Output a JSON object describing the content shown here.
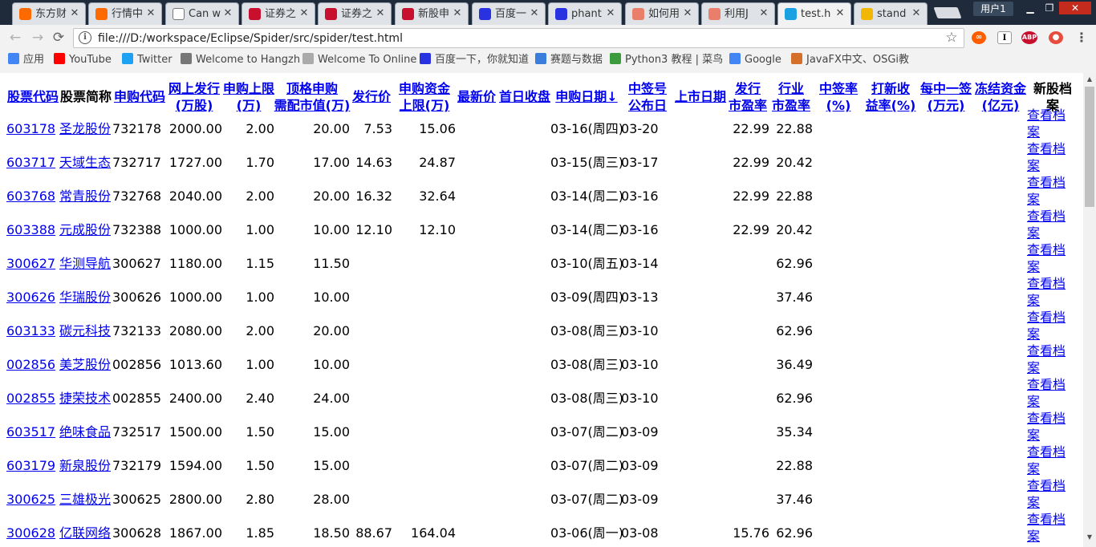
{
  "tabs": [
    {
      "title": "东方财",
      "icon_color": "#ff6a00",
      "icon": "logo-icon"
    },
    {
      "title": "行情中",
      "icon_color": "#ff6a00",
      "icon": "logo-icon"
    },
    {
      "title": "Can w",
      "icon_color": "",
      "icon": "page-icon"
    },
    {
      "title": "证券之",
      "icon_color": "#c8102e",
      "icon": "logo-icon"
    },
    {
      "title": "证券之",
      "icon_color": "#c8102e",
      "icon": "logo-icon"
    },
    {
      "title": "新股申",
      "icon_color": "#c8102e",
      "icon": "logo-icon"
    },
    {
      "title": "百度一",
      "icon_color": "#2932e1",
      "icon": "paw-icon"
    },
    {
      "title": "phant",
      "icon_color": "#2932e1",
      "icon": "paw-icon"
    },
    {
      "title": "如何用",
      "icon_color": "#e97f6a",
      "icon": "jianshu-icon"
    },
    {
      "title": "利用J",
      "icon_color": "#e97f6a",
      "icon": "jianshu-icon"
    },
    {
      "title": "test.h",
      "icon_color": "#1aa1e2",
      "icon": "globe-icon"
    },
    {
      "title": "stand",
      "icon_color": "#f2b705",
      "icon": "zhuxian-icon"
    }
  ],
  "user_button": "用户1",
  "url": "file:///D:/workspace/Eclipse/Spider/src/spider/test.html",
  "bookmarks": [
    "应用",
    "YouTube",
    "Twitter",
    "Welcome to Hangzh",
    "Welcome To Online",
    "百度一下，你就知道",
    "赛题与数据",
    "Python3 教程 | 菜鸟",
    "Google",
    "JavaFX中文、OSGi教"
  ],
  "headers": {
    "h1": "股票代码",
    "h2": "股票简称",
    "h3": "申购代码",
    "h4a": "网上发行",
    "h4b": "(万股)",
    "h5a": "申购上限",
    "h5b": "(万)",
    "h6a": "顶格申购",
    "h6b": "需配市值(万)",
    "h7": "发行价",
    "h8a": "申购资金",
    "h8b": "上限(万)",
    "h9": "最新价",
    "h10": "首日收盘",
    "h11": "申购日期↓",
    "h12a": "中签号",
    "h12b": "公布日",
    "h13": "上市日期",
    "h14a": "发行",
    "h14b": "市盈率",
    "h15a": "行业",
    "h15b": "市盈率",
    "h16a": "中签率",
    "h16b": "(%)",
    "h17a": "打新收",
    "h17b": "益率(%)",
    "h18a": "每中一签",
    "h18b": "(万元)",
    "h19a": "冻结资金",
    "h19b": "(亿元)",
    "h20a": "新股档",
    "h20b": "案"
  },
  "archive_link_a": "查看档",
  "archive_link_b": "案",
  "rows": [
    {
      "code": "603178",
      "name": "圣龙股份",
      "sub": "732178",
      "issue": "2000.00",
      "limit": "2.00",
      "mktval": "20.00",
      "price": "7.53",
      "fund": "15.06",
      "date": "03-16(周四)",
      "pub": "03-20",
      "pe": "22.99",
      "ipe": "22.88"
    },
    {
      "code": "603717",
      "name": "天域生态",
      "sub": "732717",
      "issue": "1727.00",
      "limit": "1.70",
      "mktval": "17.00",
      "price": "14.63",
      "fund": "24.87",
      "date": "03-15(周三)",
      "pub": "03-17",
      "pe": "22.99",
      "ipe": "20.42"
    },
    {
      "code": "603768",
      "name": "常青股份",
      "sub": "732768",
      "issue": "2040.00",
      "limit": "2.00",
      "mktval": "20.00",
      "price": "16.32",
      "fund": "32.64",
      "date": "03-14(周二)",
      "pub": "03-16",
      "pe": "22.99",
      "ipe": "22.88"
    },
    {
      "code": "603388",
      "name": "元成股份",
      "sub": "732388",
      "issue": "1000.00",
      "limit": "1.00",
      "mktval": "10.00",
      "price": "12.10",
      "fund": "12.10",
      "date": "03-14(周二)",
      "pub": "03-16",
      "pe": "22.99",
      "ipe": "20.42"
    },
    {
      "code": "300627",
      "name": "华测导航",
      "sub": "300627",
      "issue": "1180.00",
      "limit": "1.15",
      "mktval": "11.50",
      "price": "",
      "fund": "",
      "date": "03-10(周五)",
      "pub": "03-14",
      "pe": "",
      "ipe": "62.96"
    },
    {
      "code": "300626",
      "name": "华瑞股份",
      "sub": "300626",
      "issue": "1000.00",
      "limit": "1.00",
      "mktval": "10.00",
      "price": "",
      "fund": "",
      "date": "03-09(周四)",
      "pub": "03-13",
      "pe": "",
      "ipe": "37.46"
    },
    {
      "code": "603133",
      "name": "碳元科技",
      "sub": "732133",
      "issue": "2080.00",
      "limit": "2.00",
      "mktval": "20.00",
      "price": "",
      "fund": "",
      "date": "03-08(周三)",
      "pub": "03-10",
      "pe": "",
      "ipe": "62.96"
    },
    {
      "code": "002856",
      "name": "美芝股份",
      "sub": "002856",
      "issue": "1013.60",
      "limit": "1.00",
      "mktval": "10.00",
      "price": "",
      "fund": "",
      "date": "03-08(周三)",
      "pub": "03-10",
      "pe": "",
      "ipe": "36.49"
    },
    {
      "code": "002855",
      "name": "捷荣技术",
      "sub": "002855",
      "issue": "2400.00",
      "limit": "2.40",
      "mktval": "24.00",
      "price": "",
      "fund": "",
      "date": "03-08(周三)",
      "pub": "03-10",
      "pe": "",
      "ipe": "62.96"
    },
    {
      "code": "603517",
      "name": "绝味食品",
      "sub": "732517",
      "issue": "1500.00",
      "limit": "1.50",
      "mktval": "15.00",
      "price": "",
      "fund": "",
      "date": "03-07(周二)",
      "pub": "03-09",
      "pe": "",
      "ipe": "35.34"
    },
    {
      "code": "603179",
      "name": "新泉股份",
      "sub": "732179",
      "issue": "1594.00",
      "limit": "1.50",
      "mktval": "15.00",
      "price": "",
      "fund": "",
      "date": "03-07(周二)",
      "pub": "03-09",
      "pe": "",
      "ipe": "22.88"
    },
    {
      "code": "300625",
      "name": "三雄极光",
      "sub": "300625",
      "issue": "2800.00",
      "limit": "2.80",
      "mktval": "28.00",
      "price": "",
      "fund": "",
      "date": "03-07(周二)",
      "pub": "03-09",
      "pe": "",
      "ipe": "37.46"
    },
    {
      "code": "300628",
      "name": "亿联网络",
      "sub": "300628",
      "issue": "1867.00",
      "limit": "1.85",
      "mktval": "18.50",
      "price": "88.67",
      "fund": "164.04",
      "date": "03-06(周一)",
      "pub": "03-08",
      "pe": "15.76",
      "ipe": "62.96"
    }
  ]
}
